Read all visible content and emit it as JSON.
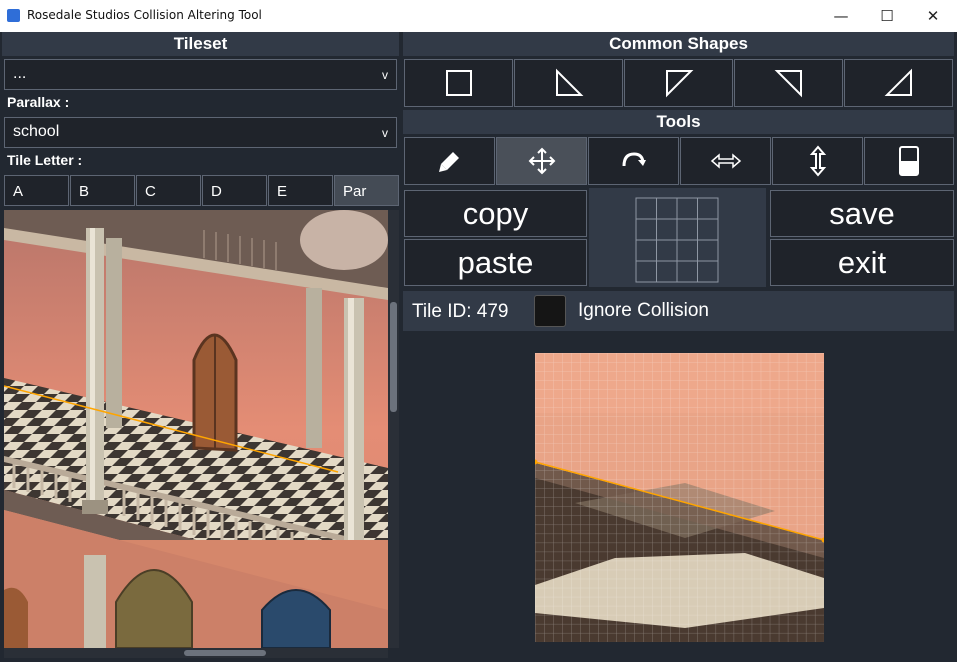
{
  "window": {
    "title": "Rosedale Studios Collision Altering Tool",
    "minimize": "—",
    "maximize": "☐",
    "close": "✕"
  },
  "left": {
    "tileset_header": "Tileset",
    "tileset_value": "...",
    "parallax_label": "Parallax :",
    "parallax_value": "school",
    "tile_letter_label": "Tile Letter :",
    "letters": [
      "A",
      "B",
      "C",
      "D",
      "E",
      "Par"
    ],
    "active_letter": "Par"
  },
  "right": {
    "shapes_header": "Common Shapes",
    "shapes": [
      "square-icon",
      "triangle-bottom-left-icon",
      "triangle-top-left-icon",
      "triangle-top-right-icon",
      "triangle-bottom-right-icon"
    ],
    "tools_header": "Tools",
    "tools": [
      "pencil-icon",
      "move-icon",
      "rotate-icon",
      "flip-horizontal-icon",
      "flip-vertical-icon",
      "fill-half-icon"
    ],
    "active_tool": "move-icon",
    "copy": "copy",
    "paste": "paste",
    "save": "save",
    "exit": "exit",
    "tile_id": "Tile ID: 479",
    "ignore_collision": "Ignore Collision",
    "ignore_collision_checked": false
  },
  "colors": {
    "panel": "#323a47",
    "background": "#222831",
    "button": "#1f232a",
    "border": "#5d6573",
    "collision_line": "#ffa500"
  }
}
